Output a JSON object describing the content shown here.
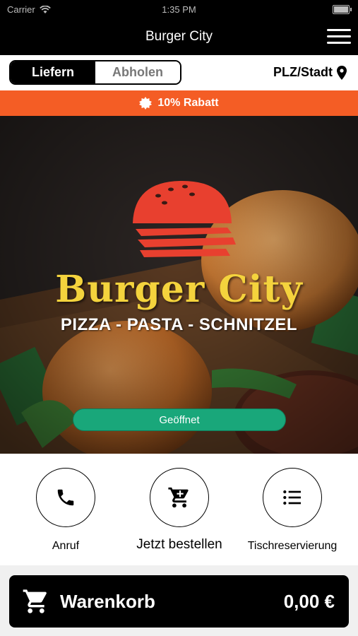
{
  "status_bar": {
    "carrier": "Carrier",
    "time": "1:35 PM"
  },
  "nav": {
    "title": "Burger City",
    "menu_icon": "hamburger-menu-icon"
  },
  "order_mode": {
    "options": [
      "Liefern",
      "Abholen"
    ],
    "selected": "Liefern"
  },
  "location": {
    "label": "PLZ/Stadt",
    "icon": "location-pin-icon"
  },
  "promo": {
    "text": "10% Rabatt",
    "icon": "badge-icon",
    "color": "#f45d25"
  },
  "hero": {
    "brand": "Burger City",
    "tagline": "PIZZA - PASTA - SCHNITZEL",
    "status": "Geöffnet",
    "status_color": "#19a77a"
  },
  "actions": [
    {
      "label": "Anruf",
      "icon": "phone-icon"
    },
    {
      "label": "Jetzt bestellen",
      "icon": "cart-icon"
    },
    {
      "label": "Tischreservierung",
      "icon": "list-icon"
    }
  ],
  "cart": {
    "label": "Warenkorb",
    "total": "0,00 €",
    "icon": "cart-icon"
  }
}
